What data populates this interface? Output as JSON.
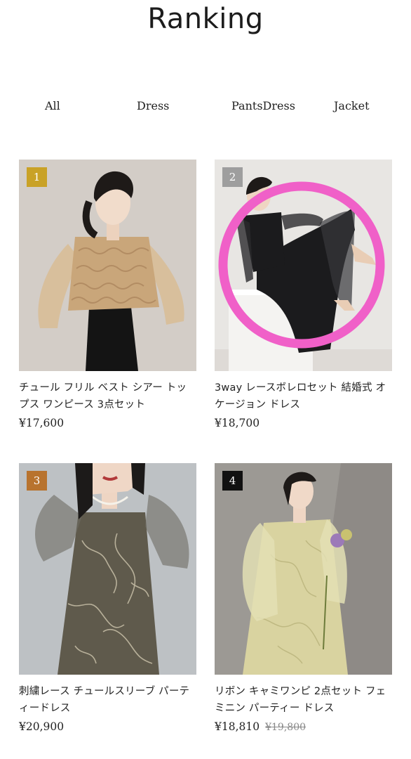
{
  "page": {
    "title": "Ranking"
  },
  "tabs": [
    "All",
    "Dress",
    "PantsDress",
    "Jacket"
  ],
  "products": [
    {
      "rank": "1",
      "name": "チュール フリル ベスト シアー トップス ワンピース 3点セット",
      "price": "¥17,600",
      "badge_color": "#c9a227"
    },
    {
      "rank": "2",
      "name": "3way レースボレロセット 結婚式 オケージョン ドレス",
      "price": "¥18,700",
      "badge_color": "#9e9e9e"
    },
    {
      "rank": "3",
      "name": "刺繍レース チュールスリーブ パーティードレス",
      "price": "¥20,900",
      "badge_color": "#b8732e"
    },
    {
      "rank": "4",
      "name": "リボン キャミワンピ 2点セット フェミニン パーティー ドレス",
      "price": "¥18,810",
      "original_price": "¥19,800",
      "badge_color": "#111111"
    }
  ],
  "highlight": {
    "color": "#f060c8",
    "target": "product-2-image"
  }
}
